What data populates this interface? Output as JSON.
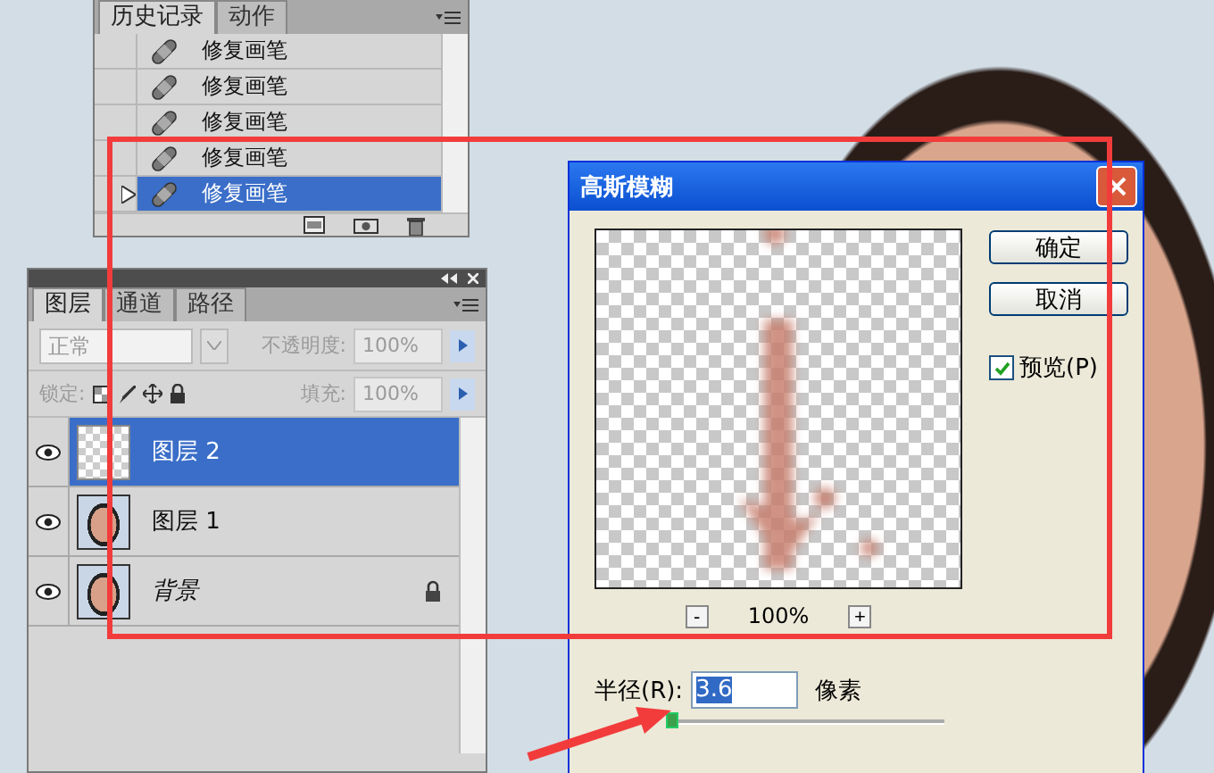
{
  "history_panel": {
    "tabs": [
      {
        "label": "历史记录",
        "selected": true
      },
      {
        "label": "动作",
        "selected": false
      }
    ],
    "items": [
      {
        "label": "修复画笔",
        "selected": false
      },
      {
        "label": "修复画笔",
        "selected": false
      },
      {
        "label": "修复画笔",
        "selected": false
      },
      {
        "label": "修复画笔",
        "selected": false
      },
      {
        "label": "修复画笔",
        "selected": true
      }
    ]
  },
  "layers_panel": {
    "tabs": [
      {
        "label": "图层",
        "selected": true
      },
      {
        "label": "通道",
        "selected": false
      },
      {
        "label": "路径",
        "selected": false
      }
    ],
    "options_disabled": true,
    "blend_mode": "正常",
    "opacity_label": "不透明度:",
    "opacity": "100%",
    "lock_label": "锁定:",
    "fill_label": "填充:",
    "fill": "100%",
    "layers": [
      {
        "name": "图层 2",
        "kind": "transparent",
        "selected": true,
        "visible": true,
        "locked": false
      },
      {
        "name": "图层 1",
        "kind": "photo",
        "selected": false,
        "visible": true,
        "locked": false
      },
      {
        "name": "背景",
        "kind": "background",
        "selected": false,
        "visible": true,
        "locked": true
      }
    ]
  },
  "dialog": {
    "title": "高斯模糊",
    "buttons": [
      "确定",
      "取消"
    ],
    "preview": {
      "label": "预览(P)",
      "checked": true
    },
    "zoom_out": "-",
    "zoom": "100%",
    "zoom_in": "+",
    "radius_label": "半径(R):",
    "radius": "3.6",
    "unit": "像素",
    "radius_slider": {
      "level": 0.02
    }
  }
}
